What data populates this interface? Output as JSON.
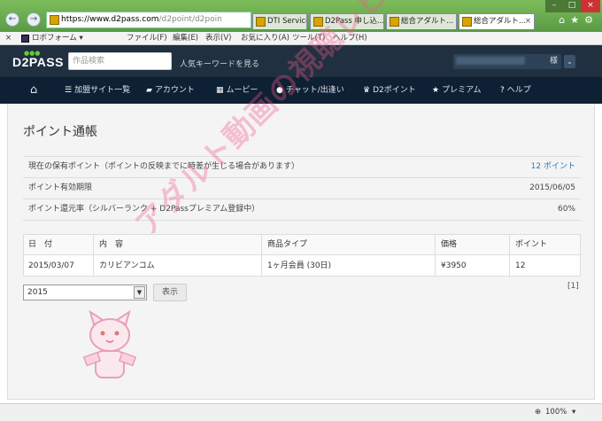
{
  "browser": {
    "url_host": "https://www.d2pass.com",
    "url_path": "/d2point/d2poin",
    "tabs": [
      {
        "label": "DTI Services, In..."
      },
      {
        "label": "D2Pass 申し込..."
      },
      {
        "label": "総合アダルト..."
      },
      {
        "label": "総合アダルト..."
      }
    ],
    "close_tab": "×"
  },
  "menubar": {
    "close": "×",
    "roboform": "ロボフォーム ▾",
    "items": [
      "ファイル(F)",
      "編集(E)",
      "表示(V)",
      "お気に入り(A)",
      "ツール(T)",
      "ヘルプ(H)"
    ]
  },
  "header": {
    "logo": "D2PASS",
    "search_placeholder": "作品検索",
    "keyword_link": "人気キーワードを見る",
    "user_suffix": "様",
    "dropdown": "⌄"
  },
  "nav": {
    "items": [
      {
        "label": ""
      },
      {
        "label": "加盟サイト一覧"
      },
      {
        "label": "アカウント"
      },
      {
        "label": "ムービー"
      },
      {
        "label": "チャット/出逢い"
      },
      {
        "label": "D2ポイント"
      },
      {
        "label": "プレミアム"
      },
      {
        "label": "ヘルプ"
      }
    ]
  },
  "page": {
    "title": "ポイント通帳",
    "info": [
      {
        "label": "現在の保有ポイント（ポイントの反映までに時差が生じる場合があります）",
        "value": "12 ポイント"
      },
      {
        "label": "ポイント有効期限",
        "value": "2015/06/05"
      },
      {
        "label": "ポイント還元率（シルバーランク + D2Passプレミアム登録中）",
        "value": "60%"
      }
    ],
    "table": {
      "headers": [
        "日　付",
        "内　容",
        "商品タイプ",
        "価格",
        "ポイント"
      ],
      "rows": [
        [
          "2015/03/07",
          "カリビアンコム",
          "1ヶ月会員 (30日)",
          "¥3950",
          "12"
        ]
      ]
    },
    "year_select": "2015",
    "show_button": "表示",
    "pager": "[1]"
  },
  "status": {
    "zoom": "100%"
  },
  "watermark": "アダルト動画の視聴レビュー"
}
